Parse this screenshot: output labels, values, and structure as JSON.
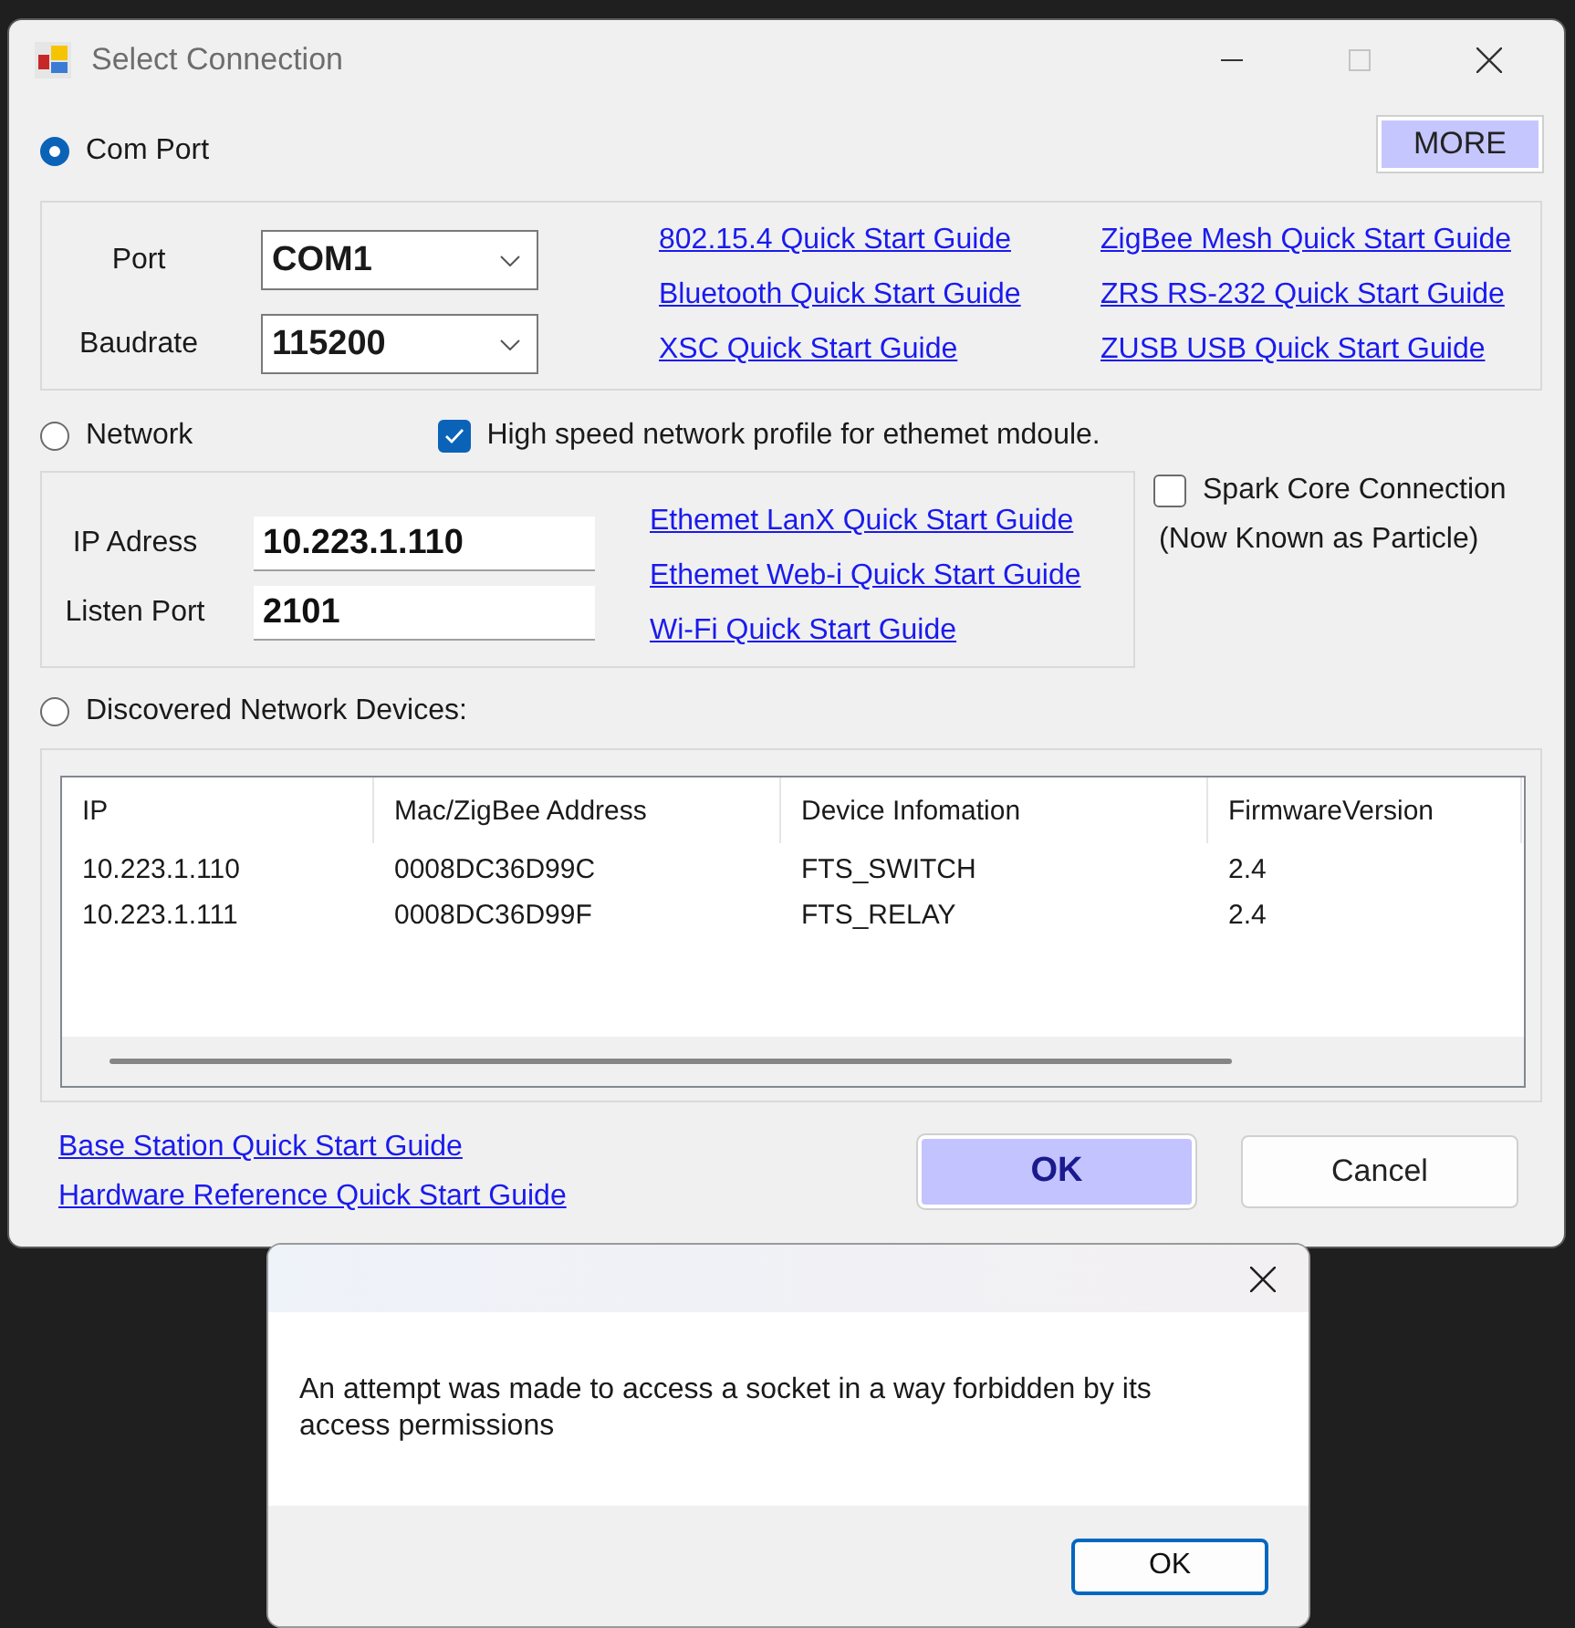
{
  "window": {
    "title": "Select Connection"
  },
  "com_port": {
    "label": "Com Port",
    "selected": true
  },
  "more_button": {
    "label": "MORE"
  },
  "com_group": {
    "fields": [
      {
        "label": "Port",
        "value": "COM1"
      },
      {
        "label": "Baudrate",
        "value": "115200"
      }
    ],
    "link_columns": [
      [
        "802.15.4 Quick Start Guide",
        "Bluetooth Quick Start Guide",
        "XSC Quick Start Guide"
      ],
      [
        "ZigBee Mesh Quick Start Guide",
        "ZRS RS-232 Quick Start Guide",
        "ZUSB USB Quick Start Guide"
      ]
    ]
  },
  "network": {
    "label": "Network",
    "selected": false
  },
  "high_speed": {
    "label": "High speed network profile for ethemet mdoule.",
    "checked": true
  },
  "network_group": {
    "fields": [
      {
        "label": "IP Adress",
        "value": "10.223.1.110"
      },
      {
        "label": "Listen Port",
        "value": "2101"
      }
    ],
    "links": [
      "Ethemet LanX Quick Start Guide",
      "Ethemet Web-i Quick Start Guide",
      "Wi-Fi Quick Start Guide"
    ]
  },
  "spark": {
    "label": "Spark Core Connection",
    "checked": false,
    "note": "(Now Known as Particle)"
  },
  "discovered": {
    "label": "Discovered Network Devices:",
    "selected": false
  },
  "table": {
    "columns": [
      "IP",
      "Mac/ZigBee Address",
      "Device Infomation",
      "FirmwareVersion"
    ],
    "rows": [
      [
        "10.223.1.110",
        "0008DC36D99C",
        "FTS_SWITCH",
        "2.4"
      ],
      [
        "10.223.1.111",
        "0008DC36D99F",
        "FTS_RELAY",
        "2.4"
      ]
    ]
  },
  "bottom_links": [
    "Base Station Quick Start Guide",
    "Hardware Reference Quick Start Guide"
  ],
  "buttons": [
    {
      "label": "OK",
      "kind": "primary"
    },
    {
      "label": "Cancel",
      "kind": "normal"
    }
  ],
  "message_box": {
    "message": "An attempt was made to access a socket in a way forbidden by its access permissions",
    "button": "OK"
  }
}
